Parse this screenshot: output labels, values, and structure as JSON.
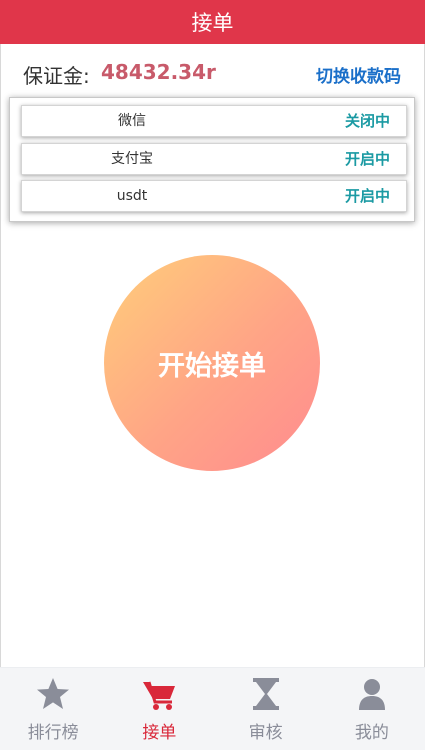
{
  "header": {
    "title": "接单"
  },
  "deposit": {
    "label": "保证金:",
    "amount": "48432.34r",
    "switch_label": "切换收款码"
  },
  "channels": [
    {
      "name": "微信",
      "status": "关闭中"
    },
    {
      "name": "支付宝",
      "status": "开启中"
    },
    {
      "name": "usdt",
      "status": "开启中"
    }
  ],
  "start_button": {
    "label": "开始接单"
  },
  "tabbar": {
    "items": [
      {
        "label": "排行榜",
        "icon": "star-icon",
        "active": false
      },
      {
        "label": "接单",
        "icon": "cart-icon",
        "active": true
      },
      {
        "label": "审核",
        "icon": "hourglass-icon",
        "active": false
      },
      {
        "label": "我的",
        "icon": "user-icon",
        "active": false
      }
    ]
  },
  "colors": {
    "header": "#e0364a",
    "accent": "#d9283a",
    "status": "#1b9aa3",
    "link": "#1a6fc9",
    "amount": "#c85a6a",
    "tab_inactive": "#8a8d99"
  }
}
